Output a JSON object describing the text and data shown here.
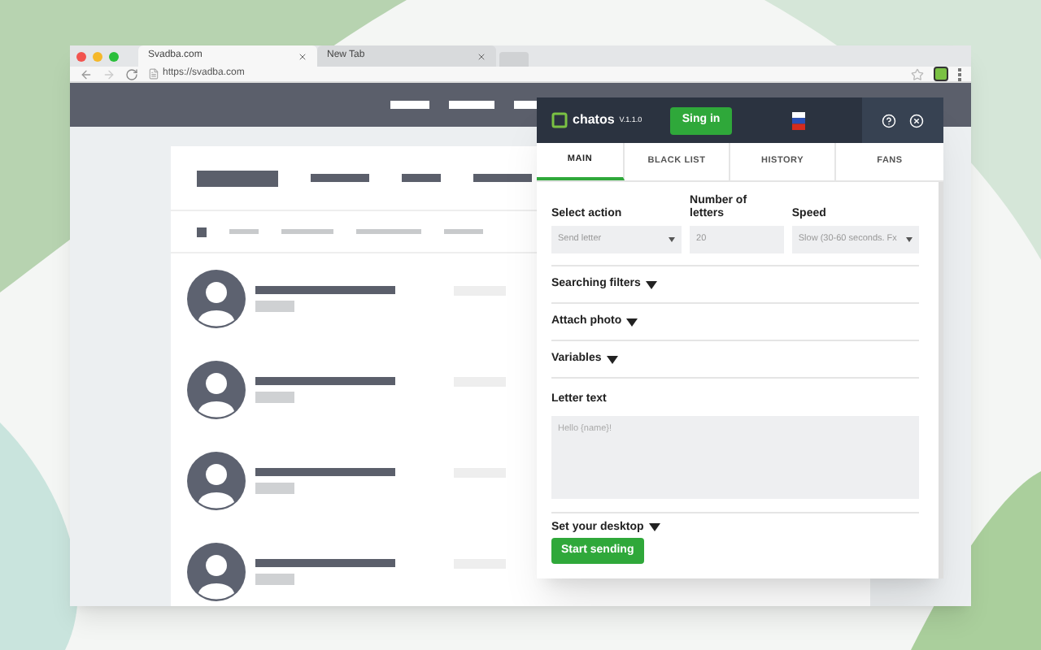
{
  "browser": {
    "tabs": [
      {
        "title": "Svadba.com",
        "selected": true
      },
      {
        "title": "New Tab",
        "selected": false
      }
    ],
    "url": "https://svadba.com"
  },
  "extension": {
    "brand": "chatos",
    "version": "V.1.1.0",
    "sign_in": "Sing in",
    "tabs": [
      {
        "label": "MAIN",
        "selected": true
      },
      {
        "label": "BLACK LIST",
        "selected": false
      },
      {
        "label": "HISTORY",
        "selected": false
      },
      {
        "label": "FANS",
        "selected": false
      }
    ],
    "fields": [
      {
        "label": "Select action",
        "value": "Send letter",
        "kind": "select"
      },
      {
        "label": "Number of letters",
        "value": "20",
        "kind": "input"
      },
      {
        "label": "Speed",
        "value": "Slow (30-60 seconds. Fx",
        "kind": "select"
      }
    ],
    "sections": [
      "Searching filters",
      "Attach photo",
      "Variables"
    ],
    "letter_text": {
      "label": "Letter text",
      "placeholder": "Hello {name}!"
    },
    "desktop": "Set your desktop",
    "start": "Start sending"
  }
}
